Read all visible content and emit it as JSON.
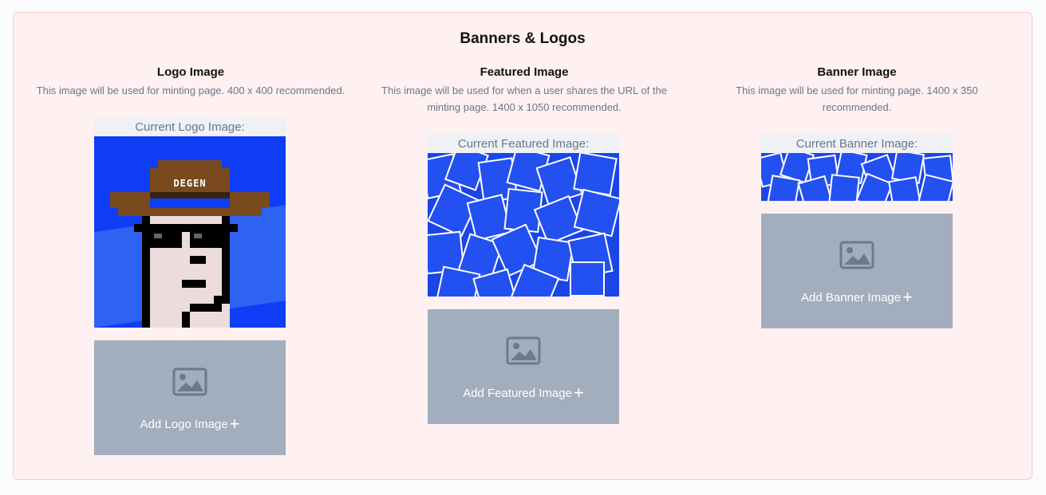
{
  "section": {
    "title": "Banners & Logos"
  },
  "logo": {
    "title": "Logo Image",
    "description": "This image will be used for minting page. 400 x 400 recommended.",
    "current_label": "Current Logo Image:",
    "avatar_text": "DEGEN",
    "add_label": "Add Logo Image"
  },
  "featured": {
    "title": "Featured Image",
    "description": "This image will be used for when a user shares the URL of the minting page. 1400 x 1050 recommended.",
    "current_label": "Current Featured Image:",
    "add_label": "Add Featured Image"
  },
  "banner": {
    "title": "Banner Image",
    "description": "This image will be used for minting page. 1400 x 350 recommended.",
    "current_label": "Current Banner Image:",
    "add_label": "Add Banner Image"
  },
  "icons": {
    "upload": "image-icon",
    "add": "plus-icon"
  },
  "colors": {
    "card_bg": "#fff1f1",
    "card_border": "#f3c9c6",
    "upload_bg": "#a2adbd",
    "muted_text": "#6b7687",
    "nft_blue": "#0f3cf5"
  }
}
